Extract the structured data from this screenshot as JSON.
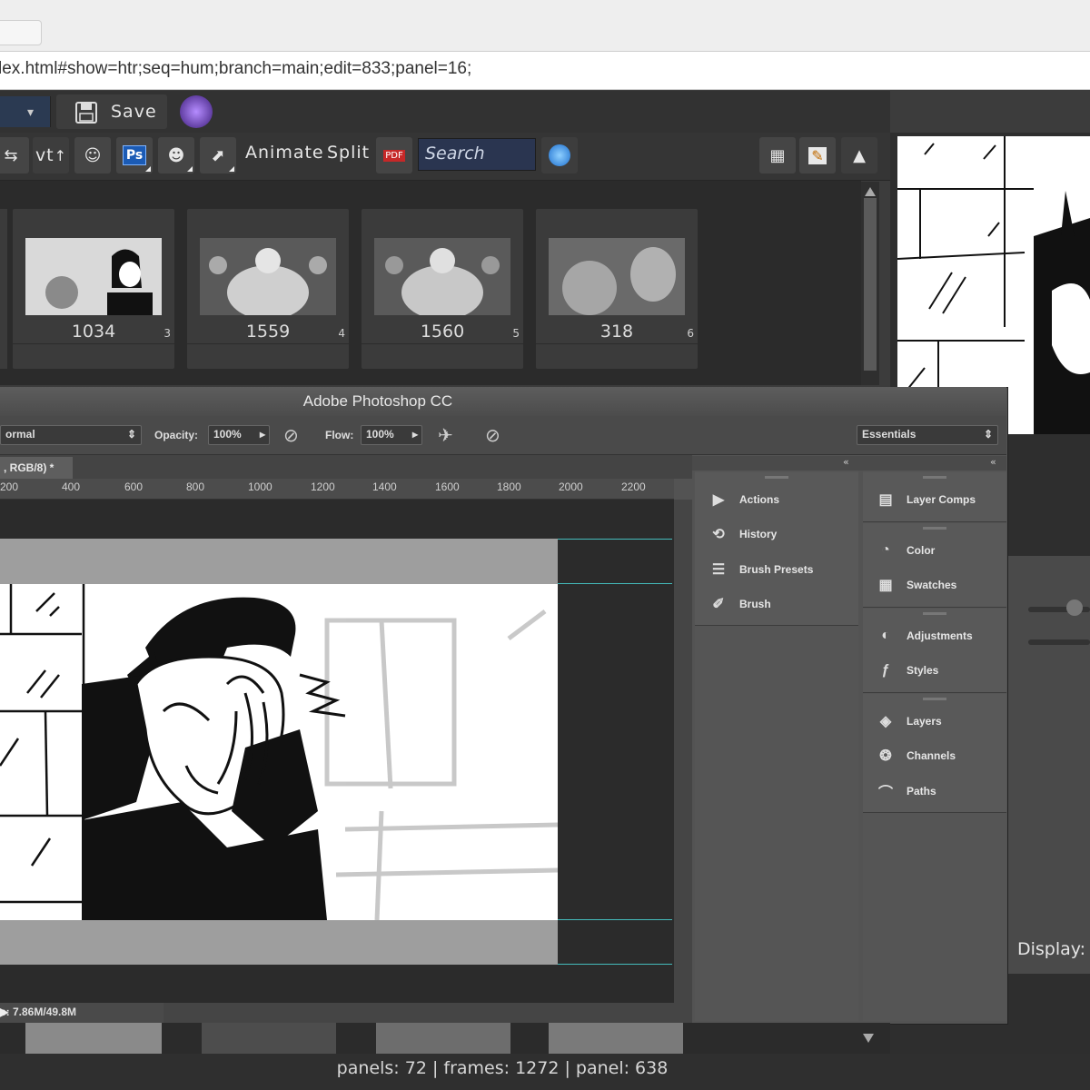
{
  "browser": {
    "url": "lex.html#show=htr;seq=hum;branch=main;edit=833;panel=16;"
  },
  "toolbar": {
    "save_label": "Save",
    "animate_label": "Animate",
    "split_label": "Split",
    "search_placeholder": "Search",
    "vt_label": "vt"
  },
  "thumbnails": [
    {
      "number": "1034",
      "index": "3"
    },
    {
      "number": "1559",
      "index": "4"
    },
    {
      "number": "1560",
      "index": "5"
    },
    {
      "number": "318",
      "index": "6"
    }
  ],
  "photoshop": {
    "title": "Adobe Photoshop CC",
    "blend_mode": "ormal",
    "opacity_label": "Opacity:",
    "opacity_value": "100%",
    "flow_label": "Flow:",
    "flow_value": "100%",
    "workspace": "Essentials",
    "doc_tab": ", RGB/8) *",
    "ruler_labels": [
      "200",
      "400",
      "600",
      "800",
      "1000",
      "1200",
      "1400",
      "1600",
      "1800",
      "2000",
      "2200"
    ],
    "status": "c: 7.86M/49.8M",
    "panels_left": [
      {
        "label": "Actions",
        "icon": "play-icon"
      },
      {
        "label": "History",
        "icon": "history-icon"
      },
      {
        "label": "Brush Presets",
        "icon": "brush-presets-icon"
      },
      {
        "label": "Brush",
        "icon": "brush-icon"
      }
    ],
    "panels_right": [
      {
        "label": "Layer Comps",
        "icon": "layer-comps-icon"
      },
      {
        "label": "Color",
        "icon": "palette-icon"
      },
      {
        "label": "Swatches",
        "icon": "swatches-icon"
      },
      {
        "label": "Adjustments",
        "icon": "adjustments-icon"
      },
      {
        "label": "Styles",
        "icon": "styles-icon"
      },
      {
        "label": "Layers",
        "icon": "layers-icon"
      },
      {
        "label": "Channels",
        "icon": "channels-icon"
      },
      {
        "label": "Paths",
        "icon": "paths-icon"
      }
    ]
  },
  "right_panel": {
    "display_label": "Display:"
  },
  "status_bar": {
    "text": "panels: 72 | frames: 1272 | panel: 638"
  }
}
